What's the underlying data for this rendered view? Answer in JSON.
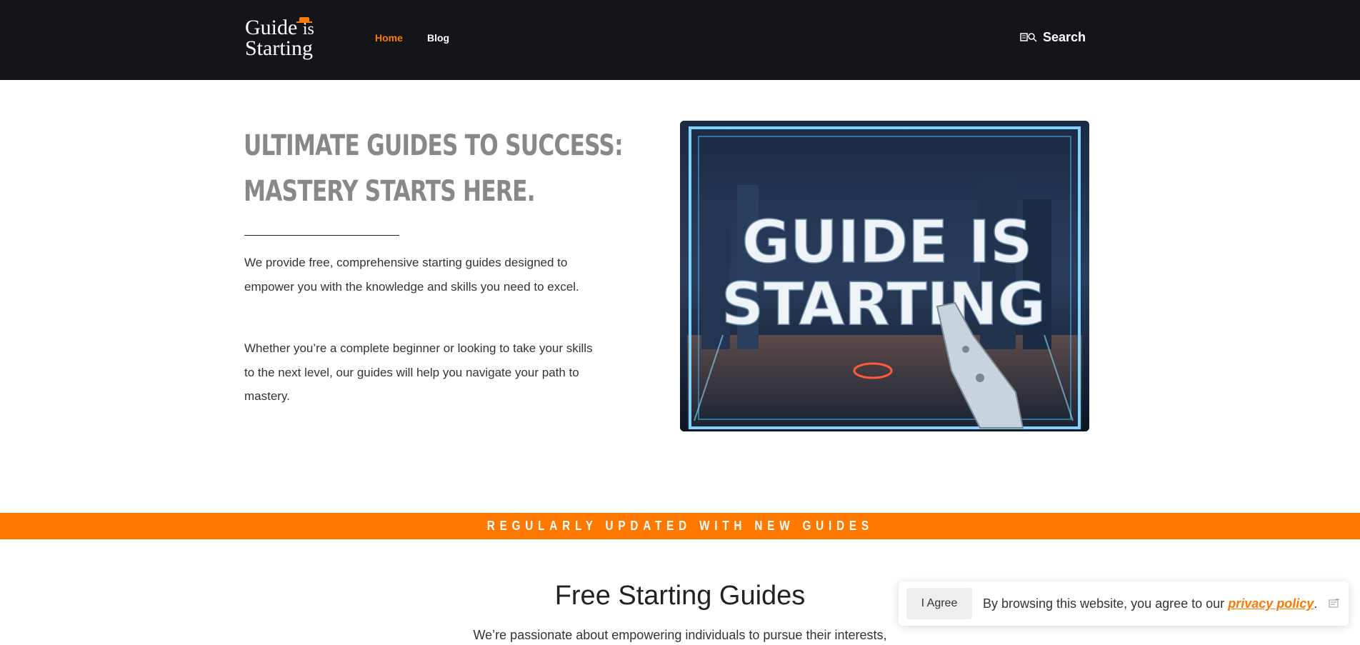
{
  "header": {
    "logo_line1": "Guide",
    "logo_is": "is",
    "logo_line2": "Starting",
    "nav": [
      {
        "label": "Home",
        "active": true
      },
      {
        "label": "Blog",
        "active": false
      }
    ],
    "search_label": "Search"
  },
  "hero": {
    "title_line1": "Ultimate Guides to Success:",
    "title_line2": "Mastery Starts Here.",
    "paragraph1": "We provide free, comprehensive starting guides designed to empower you with the knowledge and skills you need to excel.",
    "paragraph2": "Whether you’re a complete beginner or looking to take your skills to the next level, our guides will help you navigate your path to mastery.",
    "image_text_line1": "GUIDE IS",
    "image_text_line2": "STARTING"
  },
  "banner": {
    "text": "Regularly updated with new guides"
  },
  "section": {
    "title": "Free Starting Guides",
    "text": "We’re passionate about empowering individuals to pursue their interests,"
  },
  "cookie": {
    "agree_label": "I Agree",
    "text": "By browsing this website, you agree to our ",
    "link_label": "privacy policy",
    "text_end": "."
  },
  "colors": {
    "accent": "#ff7800",
    "header_bg": "#141518",
    "title_gray": "#888888"
  },
  "icons": {
    "search": "search-icon",
    "close": "close-icon"
  }
}
